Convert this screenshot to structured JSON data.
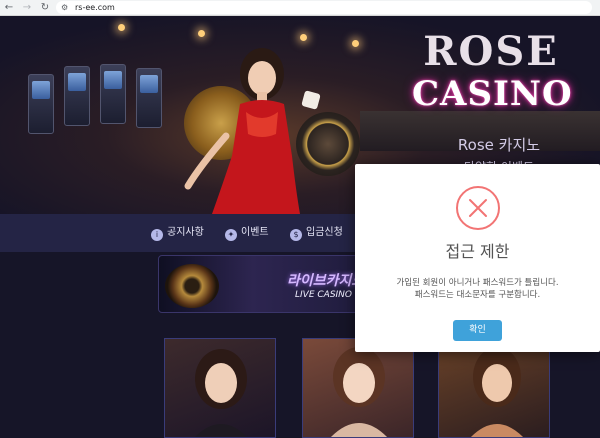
{
  "browser": {
    "url": "rs-ee.com",
    "back_icon": "arrow-left-icon",
    "forward_icon": "arrow-right-icon",
    "reload_icon": "reload-icon",
    "site_info_icon": "site-info-icon"
  },
  "hero": {
    "logo_line1": "ROSE",
    "logo_line2": "CASINO",
    "title": "Rose 카지노",
    "subtitle": "다양한 이벤트"
  },
  "menu": {
    "items": [
      {
        "label": "공지사항",
        "icon": "info-icon"
      },
      {
        "label": "이벤트",
        "icon": "gift-icon"
      },
      {
        "label": "입금신청",
        "icon": "money-bag-icon"
      }
    ]
  },
  "live_casino": {
    "title_ko": "라이브카지노",
    "title_en": "LIVE CASINO"
  },
  "modal": {
    "icon": "error-x-icon",
    "title": "접근 제한",
    "message_line1": "가입된 회원이 아니거나 패스워드가 틀립니다.",
    "message_line2": "패스워드는 대소문자를 구분합니다.",
    "confirm_label": "확인",
    "accent_color": "#3fa2da",
    "error_color": "#f27474"
  }
}
